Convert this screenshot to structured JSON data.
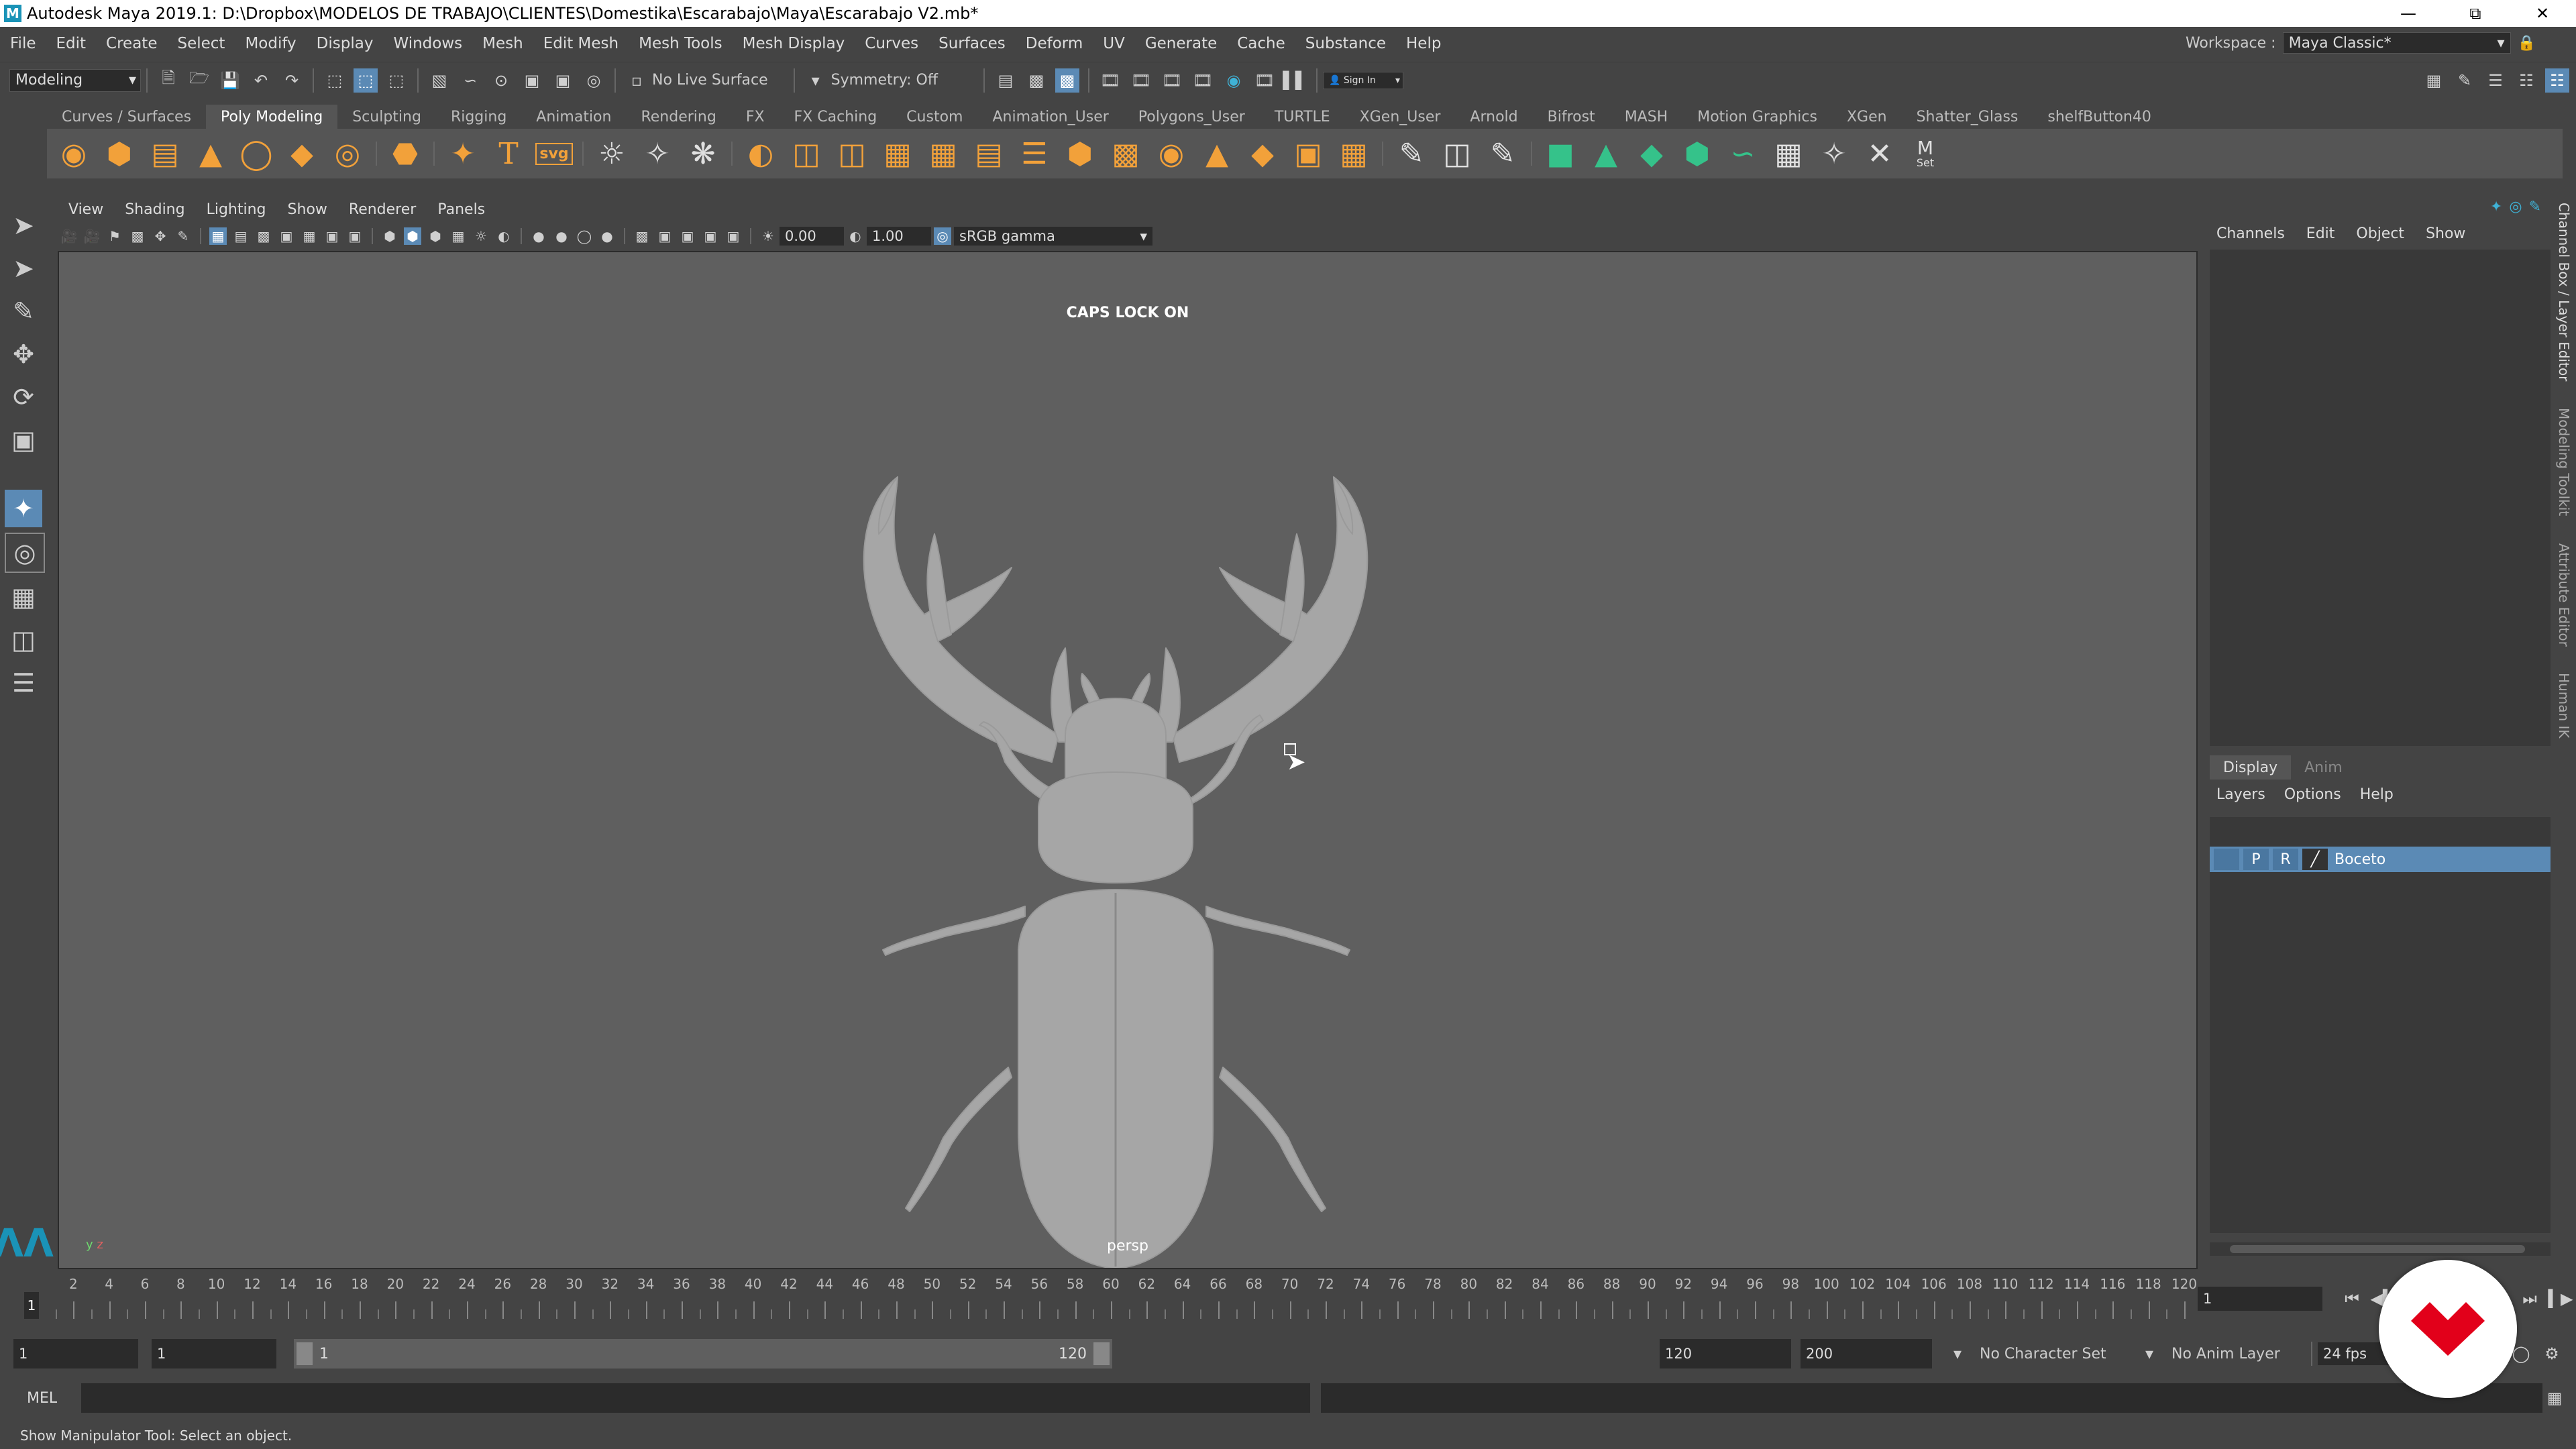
{
  "window": {
    "title": "Autodesk Maya 2019.1: D:\\Dropbox\\MODELOS DE TRABAJO\\CLIENTES\\Domestika\\Escarabajo\\Maya\\Escarabajo V2.mb*",
    "logo": "M"
  },
  "menubar": {
    "items": [
      "File",
      "Edit",
      "Create",
      "Select",
      "Modify",
      "Display",
      "Windows",
      "Mesh",
      "Edit Mesh",
      "Mesh Tools",
      "Mesh Display",
      "Curves",
      "Surfaces",
      "Deform",
      "UV",
      "Generate",
      "Cache",
      "Substance",
      "Help"
    ]
  },
  "workspace": {
    "label": "Workspace :",
    "value": "Maya Classic*"
  },
  "statusline": {
    "mode": "Modeling",
    "live_surface": "No Live Surface",
    "symmetry": "Symmetry: Off",
    "sign_in": "Sign In"
  },
  "shelf": {
    "tabs": [
      "Curves / Surfaces",
      "Poly Modeling",
      "Sculpting",
      "Rigging",
      "Animation",
      "Rendering",
      "FX",
      "FX Caching",
      "Custom",
      "Animation_User",
      "Polygons_User",
      "TURTLE",
      "XGen_User",
      "Arnold",
      "Bifrost",
      "MASH",
      "Motion Graphics",
      "XGen",
      "Shatter_Glass",
      "shelfButton40"
    ],
    "active_tab": "Poly Modeling",
    "svg_label": "svg",
    "set_label": "Set"
  },
  "viewport": {
    "menu": [
      "View",
      "Shading",
      "Lighting",
      "Show",
      "Renderer",
      "Panels"
    ],
    "exposure": "0.00",
    "gamma": "1.00",
    "color_space": "sRGB gamma",
    "caps_lock": "CAPS LOCK ON",
    "camera": "persp",
    "axis_y": "y",
    "axis_z": "z"
  },
  "right_panel": {
    "menu": [
      "Channels",
      "Edit",
      "Object",
      "Show"
    ],
    "tabs": [
      "Display",
      "Anim"
    ],
    "layer_menu": [
      "Layers",
      "Options",
      "Help"
    ],
    "layer": {
      "p": "P",
      "r": "R",
      "name": "Boceto"
    },
    "side_tabs": [
      "Channel Box / Layer Editor",
      "Modeling Toolkit",
      "Attribute Editor",
      "Human IK"
    ]
  },
  "timeline": {
    "labels": [
      "2",
      "4",
      "6",
      "8",
      "10",
      "12",
      "14",
      "16",
      "18",
      "20",
      "22",
      "24",
      "26",
      "28",
      "30",
      "32",
      "34",
      "36",
      "38",
      "40",
      "42",
      "44",
      "46",
      "48",
      "50",
      "52",
      "54",
      "56",
      "58",
      "60",
      "62",
      "64",
      "66",
      "68",
      "70",
      "72",
      "74",
      "76",
      "78",
      "80",
      "82",
      "84",
      "86",
      "88",
      "90",
      "92",
      "94",
      "96",
      "98",
      "100",
      "102",
      "104",
      "106",
      "108",
      "110",
      "112",
      "114",
      "116",
      "118",
      "120"
    ],
    "current_marker": "1",
    "current_frame": "1"
  },
  "range": {
    "start": "1",
    "anim_start": "1",
    "slider_start": "1",
    "slider_end": "120",
    "end": "120",
    "anim_end": "200",
    "character_set": "No Character Set",
    "anim_layer": "No Anim Layer",
    "fps": "24 fps"
  },
  "cmdline": {
    "lang": "MEL"
  },
  "helpline": {
    "text": "Show Manipulator Tool: Select an object."
  },
  "colors": {
    "accent": "#5b8ab5",
    "badge": "#e2001a"
  }
}
